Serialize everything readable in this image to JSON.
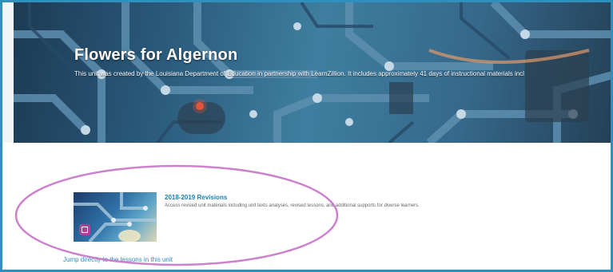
{
  "banner": {
    "title": "Flowers for Algernon",
    "description": "This unit was created by the Louisiana Department of Education in partnership with LearnZillion. It includes approximately 41 days of instructional materials incl"
  },
  "card": {
    "title": "2018-2019 Revisions",
    "description": "Access revised unit materials including unit texts analyses, revised lessons, and additional supports for diverse learners.",
    "thumbnail_icon": "lesson-badge-icon"
  },
  "links": {
    "jump_label": "Jump directly to the lessons in this unit"
  },
  "colors": {
    "frame_border": "#2f8fbd",
    "link_blue": "#1a7fb5",
    "annotation_circle": "#c673c9",
    "badge_magenta": "#b23f9c"
  }
}
